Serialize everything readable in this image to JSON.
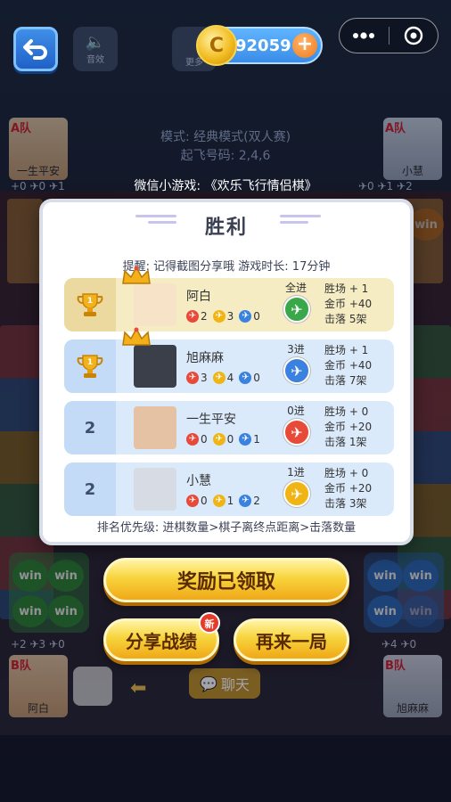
{
  "topbar": {
    "sound_label": "音效",
    "more_label": "更多",
    "coins": "92059",
    "coin_symbol": "C",
    "plus": "+"
  },
  "mode": {
    "line1": "模式: 经典模式(双人赛)",
    "line2": "起飞号码: 2,4,6"
  },
  "caption": "微信小游戏: 《欢乐飞行情侣棋》",
  "bg_players": {
    "top_left": {
      "team": "A队",
      "name": "一生平安",
      "stats": "+0 ✈0 ✈1"
    },
    "top_right": {
      "team": "A队",
      "name": "小慧",
      "stats": "✈0 ✈1 ✈2"
    },
    "bottom_left": {
      "team": "B队",
      "name": "阿白",
      "stats": "+2 ✈3 ✈0"
    },
    "bottom_right": {
      "team": "B队",
      "name": "旭麻麻",
      "stats": "✈4 ✈0"
    }
  },
  "modal": {
    "title": "胜利",
    "reminder": "提醒: 记得截图分享哦   游戏时长: 17分钟",
    "priority": "排名优先级: 进棋数量>棋子离终点距离>击落数量",
    "rows": [
      {
        "rank": "",
        "trophy": true,
        "name": "阿白",
        "p1": "2",
        "p2": "3",
        "p3": "0",
        "entered": "全进",
        "wins": "胜场 + 1",
        "coins": "金币 +40",
        "downs": "击落 5架",
        "plane_color": "#3aa84a",
        "row_bg": "#f5ecc4",
        "rank_bg": "#ecd9a0",
        "crown": true
      },
      {
        "rank": "",
        "trophy": true,
        "name": "旭麻麻",
        "p1": "3",
        "p2": "4",
        "p3": "0",
        "entered": "3进",
        "wins": "胜场 + 1",
        "coins": "金币 +40",
        "downs": "击落 7架",
        "plane_color": "#3b82e0",
        "row_bg": "#dbeafb",
        "rank_bg": "#c3dbf6",
        "crown": true
      },
      {
        "rank": "2",
        "trophy": false,
        "name": "一生平安",
        "p1": "0",
        "p2": "0",
        "p3": "1",
        "entered": "0进",
        "wins": "胜场 + 0",
        "coins": "金币 +20",
        "downs": "击落 1架",
        "plane_color": "#e84a3a",
        "row_bg": "#dbeafb",
        "rank_bg": "#c3dbf6",
        "crown": false
      },
      {
        "rank": "2",
        "trophy": false,
        "name": "小慧",
        "p1": "0",
        "p2": "1",
        "p3": "2",
        "entered": "1进",
        "wins": "胜场 + 0",
        "coins": "金币 +20",
        "downs": "击落 3架",
        "plane_color": "#f0b414",
        "row_bg": "#dbeafb",
        "rank_bg": "#c3dbf6",
        "crown": false
      }
    ]
  },
  "buttons": {
    "reward": "奖励已领取",
    "share": "分享战绩",
    "share_badge": "新",
    "again": "再来一局"
  },
  "chat_label": "聊天",
  "win_text": "win"
}
